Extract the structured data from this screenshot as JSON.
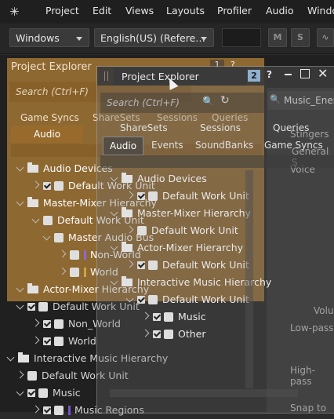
{
  "menubar": {
    "items": [
      "Project",
      "Edit",
      "Views",
      "Layouts",
      "Profiler",
      "Audio",
      "Windo"
    ]
  },
  "toolbar": {
    "platform": "Windows",
    "language": "English(US) (Refere…",
    "m_label": "M",
    "s_label": "S"
  },
  "bg_explorer": {
    "title": "Project Explorer",
    "search_placeholder": "Search (Ctrl+F)",
    "tabs": [
      "Game Syncs",
      "ShareSets",
      "Sessions",
      "Queries"
    ],
    "active_tab": "Audio",
    "tree": [
      "Audio Devices",
      "Default Work Unit",
      "Master-Mixer Hierarchy",
      "Default Work Unit",
      "Master Audio Bus",
      "Non-World",
      "World",
      "Actor-Mixer Hierarchy",
      "Default Work Unit",
      "Non_World",
      "World",
      "Interactive Music Hierarchy",
      "Default Work Unit",
      "Music",
      "Music Regions"
    ]
  },
  "ghost": {
    "title": "Project Explorer",
    "badge": "2",
    "search_placeholder": "Search (Ctrl+F)",
    "tabs_row1": [
      "ShareSets",
      "Sessions",
      "Queries"
    ],
    "tabs_row2": [
      "Audio",
      "Events",
      "SoundBanks",
      "Game Syncs"
    ],
    "tree": [
      "Audio Devices",
      "Default Work Unit",
      "Master-Mixer Hierarchy",
      "Default Work Unit",
      "Actor-Mixer Hierarchy",
      "Default Work Unit",
      "Interactive Music Hierarchy",
      "Default Work Unit",
      "Music",
      "Other"
    ]
  },
  "right_panel": {
    "texts": [
      "Music_Ener",
      "Stingers",
      "General S",
      "Voice",
      "Volu",
      "Low-pass",
      "High-pass",
      "Snap to"
    ]
  },
  "colors": {
    "accent_orange": "#d2943c",
    "music_bar": "#7a55c8",
    "bus_bar_1": "#8a6ad8",
    "bus_bar_2": "#c8a64a"
  }
}
